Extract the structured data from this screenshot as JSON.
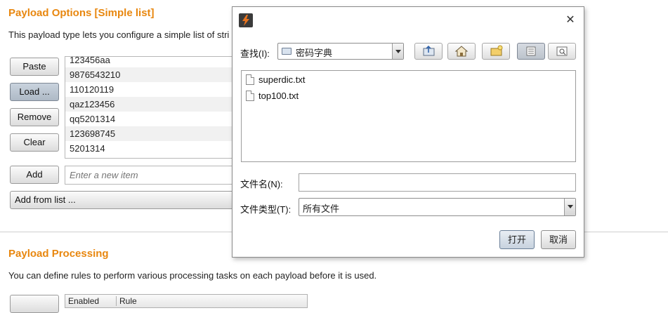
{
  "payload_options": {
    "title": "Payload Options [Simple list]",
    "description": "This payload type lets you configure a simple list of stri",
    "buttons": {
      "paste": "Paste",
      "load": "Load ...",
      "remove": "Remove",
      "clear": "Clear",
      "add": "Add",
      "add_from_list": "Add from list ..."
    },
    "items": [
      "123456aa",
      "9876543210",
      "110120119",
      "qaz123456",
      "qq5201314",
      "123698745",
      "5201314"
    ],
    "new_item_placeholder": "Enter a new item"
  },
  "payload_processing": {
    "title": "Payload Processing",
    "description": "You can define rules to perform various processing tasks on each payload before it is used.",
    "table_headers": [
      "Enabled",
      "Rule"
    ]
  },
  "dialog": {
    "look_in_label": "查找(I):",
    "look_in_value": "密码字典",
    "files": [
      "superdic.txt",
      "top100.txt"
    ],
    "file_name_label": "文件名(N):",
    "file_name_value": "",
    "file_type_label": "文件类型(T):",
    "file_type_value": "所有文件",
    "open_button": "打开",
    "cancel_button": "取消",
    "close_symbol": "✕",
    "toolbar_icons": [
      "up-folder-icon",
      "home-icon",
      "new-folder-icon",
      "list-view-icon",
      "details-view-icon"
    ]
  },
  "colors": {
    "accent": "#e8870f",
    "app_icon": "#e8731e"
  }
}
